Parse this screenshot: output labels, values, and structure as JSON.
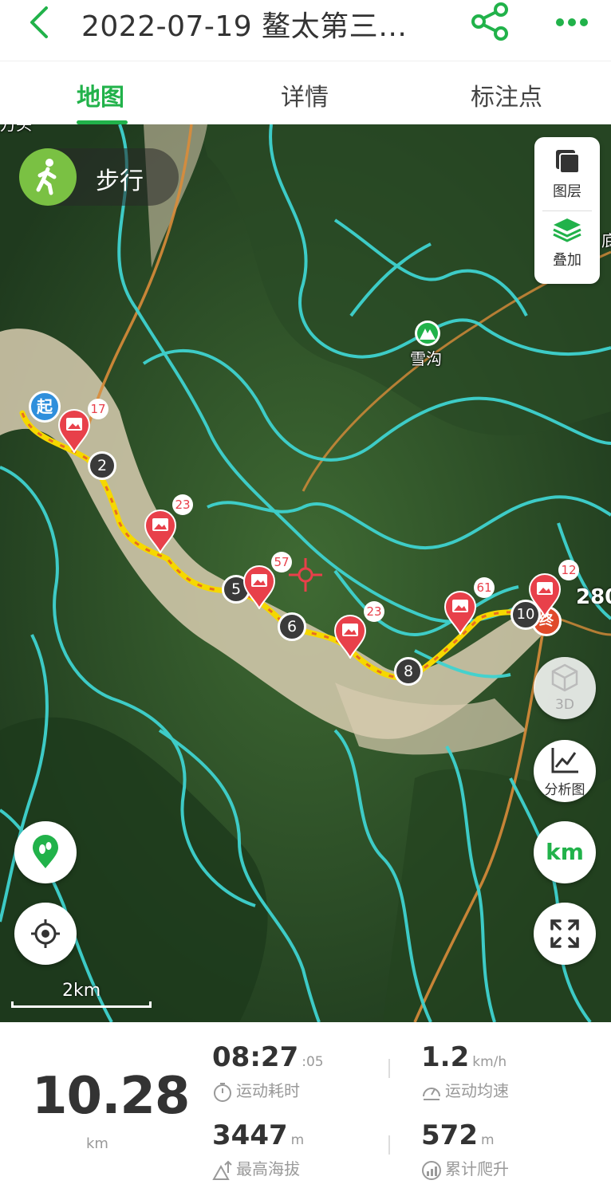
{
  "header": {
    "title": "2022-07-19 鳌太第三…"
  },
  "tabs": [
    {
      "label": "地图",
      "active": true
    },
    {
      "label": "详情",
      "active": false
    },
    {
      "label": "标注点",
      "active": false
    }
  ],
  "map": {
    "mode_label": "步行",
    "layers_label": "图层",
    "overlay_label": "叠加",
    "place_name": "雪沟",
    "start_label": "起",
    "end_label": "终",
    "partial_label_top_left": "万头",
    "partial_label_right": "底",
    "elevation_label": "280",
    "km_markers": [
      "2",
      "5",
      "6",
      "8",
      "10"
    ],
    "photo_counts": [
      "17",
      "23",
      "57",
      "23",
      "61",
      "12"
    ],
    "btn_3d_label": "3D",
    "btn_analysis_label": "分析图",
    "btn_km_label": "km",
    "scale_label": "2km"
  },
  "stats": {
    "distance_value": "10.28",
    "distance_unit": "km",
    "duration_value": "08:27",
    "duration_seconds": ":05",
    "duration_caption": "运动耗时",
    "avg_speed_value": "1.2",
    "avg_speed_unit": "km/h",
    "avg_speed_caption": "运动均速",
    "max_altitude_value": "3447",
    "max_altitude_unit": "m",
    "max_altitude_caption": "最高海拔",
    "total_climb_value": "572",
    "total_climb_unit": "m",
    "total_climb_caption": "累计爬升"
  },
  "colors": {
    "accent": "#21b24a",
    "track": "#f5d800",
    "contour": "#3fd3d0",
    "road": "#d98c3a",
    "marker": "#e8404a"
  }
}
